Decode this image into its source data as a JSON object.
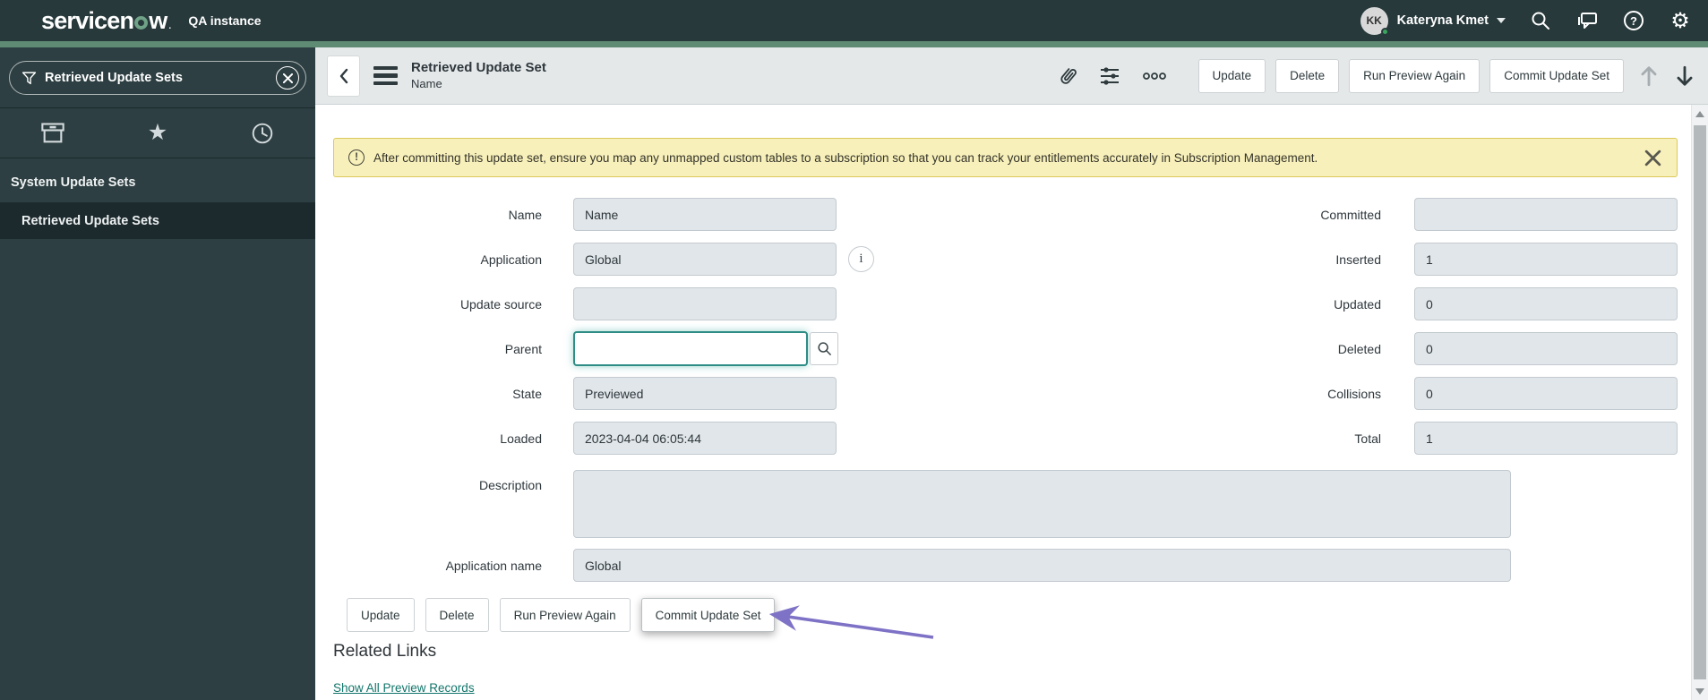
{
  "header": {
    "brand": "servicenow",
    "brand_prefix": "servicen",
    "brand_suffix": "w",
    "instance": "QA instance",
    "user": {
      "initials": "KK",
      "name": "Kateryna Kmet"
    }
  },
  "sidebar": {
    "filter_value": "Retrieved Update Sets",
    "section": "System Update Sets",
    "items": [
      {
        "label": "Retrieved Update Sets",
        "selected": true
      }
    ]
  },
  "form_header": {
    "title": "Retrieved Update Set",
    "subtitle": "Name"
  },
  "actions": {
    "update": "Update",
    "delete": "Delete",
    "run_preview": "Run Preview Again",
    "commit": "Commit Update Set"
  },
  "banner": {
    "text": "After committing this update set, ensure you map any unmapped custom tables to a subscription so that you can track your entitlements accurately in Subscription Management."
  },
  "form": {
    "left": [
      {
        "label": "Name",
        "value": "Name"
      },
      {
        "label": "Application",
        "value": "Global"
      },
      {
        "label": "Update source",
        "value": ""
      },
      {
        "label": "Parent",
        "value": ""
      },
      {
        "label": "State",
        "value": "Previewed"
      },
      {
        "label": "Loaded",
        "value": "2023-04-04 06:05:44"
      }
    ],
    "right": [
      {
        "label": "Committed",
        "value": ""
      },
      {
        "label": "Inserted",
        "value": "1"
      },
      {
        "label": "Updated",
        "value": "0"
      },
      {
        "label": "Deleted",
        "value": "0"
      },
      {
        "label": "Collisions",
        "value": "0"
      },
      {
        "label": "Total",
        "value": "1"
      }
    ],
    "description": {
      "label": "Description",
      "value": ""
    },
    "application_name": {
      "label": "Application name",
      "value": "Global"
    }
  },
  "related": {
    "heading": "Related Links",
    "links": [
      "Show All Preview Records"
    ]
  },
  "icons": {
    "help": "?",
    "info": "i",
    "alert": "!"
  },
  "colors": {
    "header_bg": "#27393b",
    "sidebar_bg": "#2d3f42",
    "accent_green": "#5f8a74",
    "selected_item_bg": "#1c2a2d",
    "form_header_bg": "#e4e8e9",
    "field_bg": "#e1e6ea",
    "banner_bg": "#f8f0ba",
    "focus_teal": "#2e8d85",
    "link_teal": "#11756a",
    "arrow_purple": "#7e72c6",
    "presence_green": "#3ba55d"
  }
}
